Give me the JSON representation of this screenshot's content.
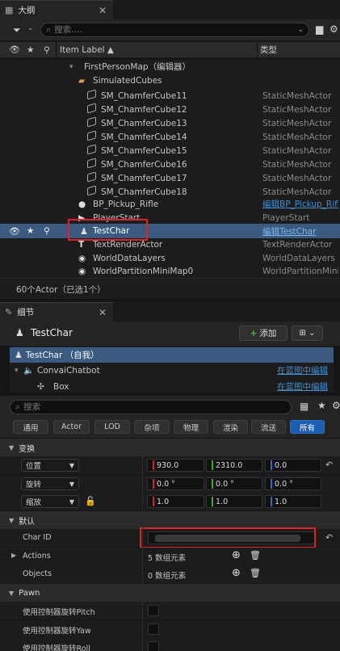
{
  "outliner": {
    "tab_title": "大纲",
    "search_placeholder": "搜索....",
    "columns": {
      "label": "Item Label ▲",
      "type": "类型"
    },
    "rows": [
      {
        "name": "FirstPersonMap（编辑器）",
        "type": ""
      },
      {
        "name": "SimulatedCubes",
        "type": ""
      },
      {
        "name": "SM_ChamferCube11",
        "type": "StaticMeshActor"
      },
      {
        "name": "SM_ChamferCube12",
        "type": "StaticMeshActor"
      },
      {
        "name": "SM_ChamferCube13",
        "type": "StaticMeshActor"
      },
      {
        "name": "SM_ChamferCube14",
        "type": "StaticMeshActor"
      },
      {
        "name": "SM_ChamferCube15",
        "type": "StaticMeshActor"
      },
      {
        "name": "SM_ChamferCube16",
        "type": "StaticMeshActor"
      },
      {
        "name": "SM_ChamferCube17",
        "type": "StaticMeshActor"
      },
      {
        "name": "SM_ChamferCube18",
        "type": "StaticMeshActor"
      },
      {
        "name": "BP_Pickup_Rifle",
        "type": "编辑BP_Pickup_Rifl"
      },
      {
        "name": "PlayerStart",
        "type": "PlayerStart"
      },
      {
        "name": "TestChar",
        "type": "编辑TestChar"
      },
      {
        "name": "TextRenderActor",
        "type": "TextRenderActor"
      },
      {
        "name": "WorldDataLayers",
        "type": "WorldDataLayers"
      },
      {
        "name": "WorldPartitionMiniMap0",
        "type": "WorldPartitionMiniM"
      }
    ],
    "status": "60个Actor（已选1个）"
  },
  "details": {
    "tab_title": "细节",
    "actor_name": "TestChar",
    "add_label": "添加",
    "components": [
      {
        "name": "TestChar （自我）"
      },
      {
        "name": "ConvaiChatbot",
        "link": "在蓝图中编辑"
      },
      {
        "name": "Box",
        "link": "在蓝图中编辑"
      }
    ],
    "search_placeholder": "搜索",
    "categories": [
      "通用",
      "Actor",
      "LOD",
      "杂项",
      "物理",
      "渲染",
      "流送",
      "所有"
    ],
    "transform": {
      "section": "变换",
      "location": {
        "label": "位置",
        "x": "930.0",
        "y": "2310.0",
        "z": "0.0"
      },
      "rotation": {
        "label": "旋转",
        "x": "0.0 °",
        "y": "0.0 °",
        "z": "0.0 °"
      },
      "scale": {
        "label": "缩放",
        "x": "1.0",
        "y": "1.0",
        "z": "1.0"
      }
    },
    "default": {
      "section": "默认",
      "char_id_label": "Char ID",
      "char_id_value": "",
      "actions_label": "Actions",
      "actions_value": "5 数组元素",
      "objects_label": "Objects",
      "objects_value": "0 数组元素"
    },
    "pawn": {
      "section": "Pawn",
      "pitch": "使用控制器旋转Pitch",
      "yaw": "使用控制器旋转Yaw",
      "roll": "使用控制器旋转Roll"
    }
  },
  "colors": {
    "accent": "#1a5fb4",
    "selection": "#3a5a80",
    "highlight": "#e0212c",
    "link": "#3d8fd6"
  }
}
